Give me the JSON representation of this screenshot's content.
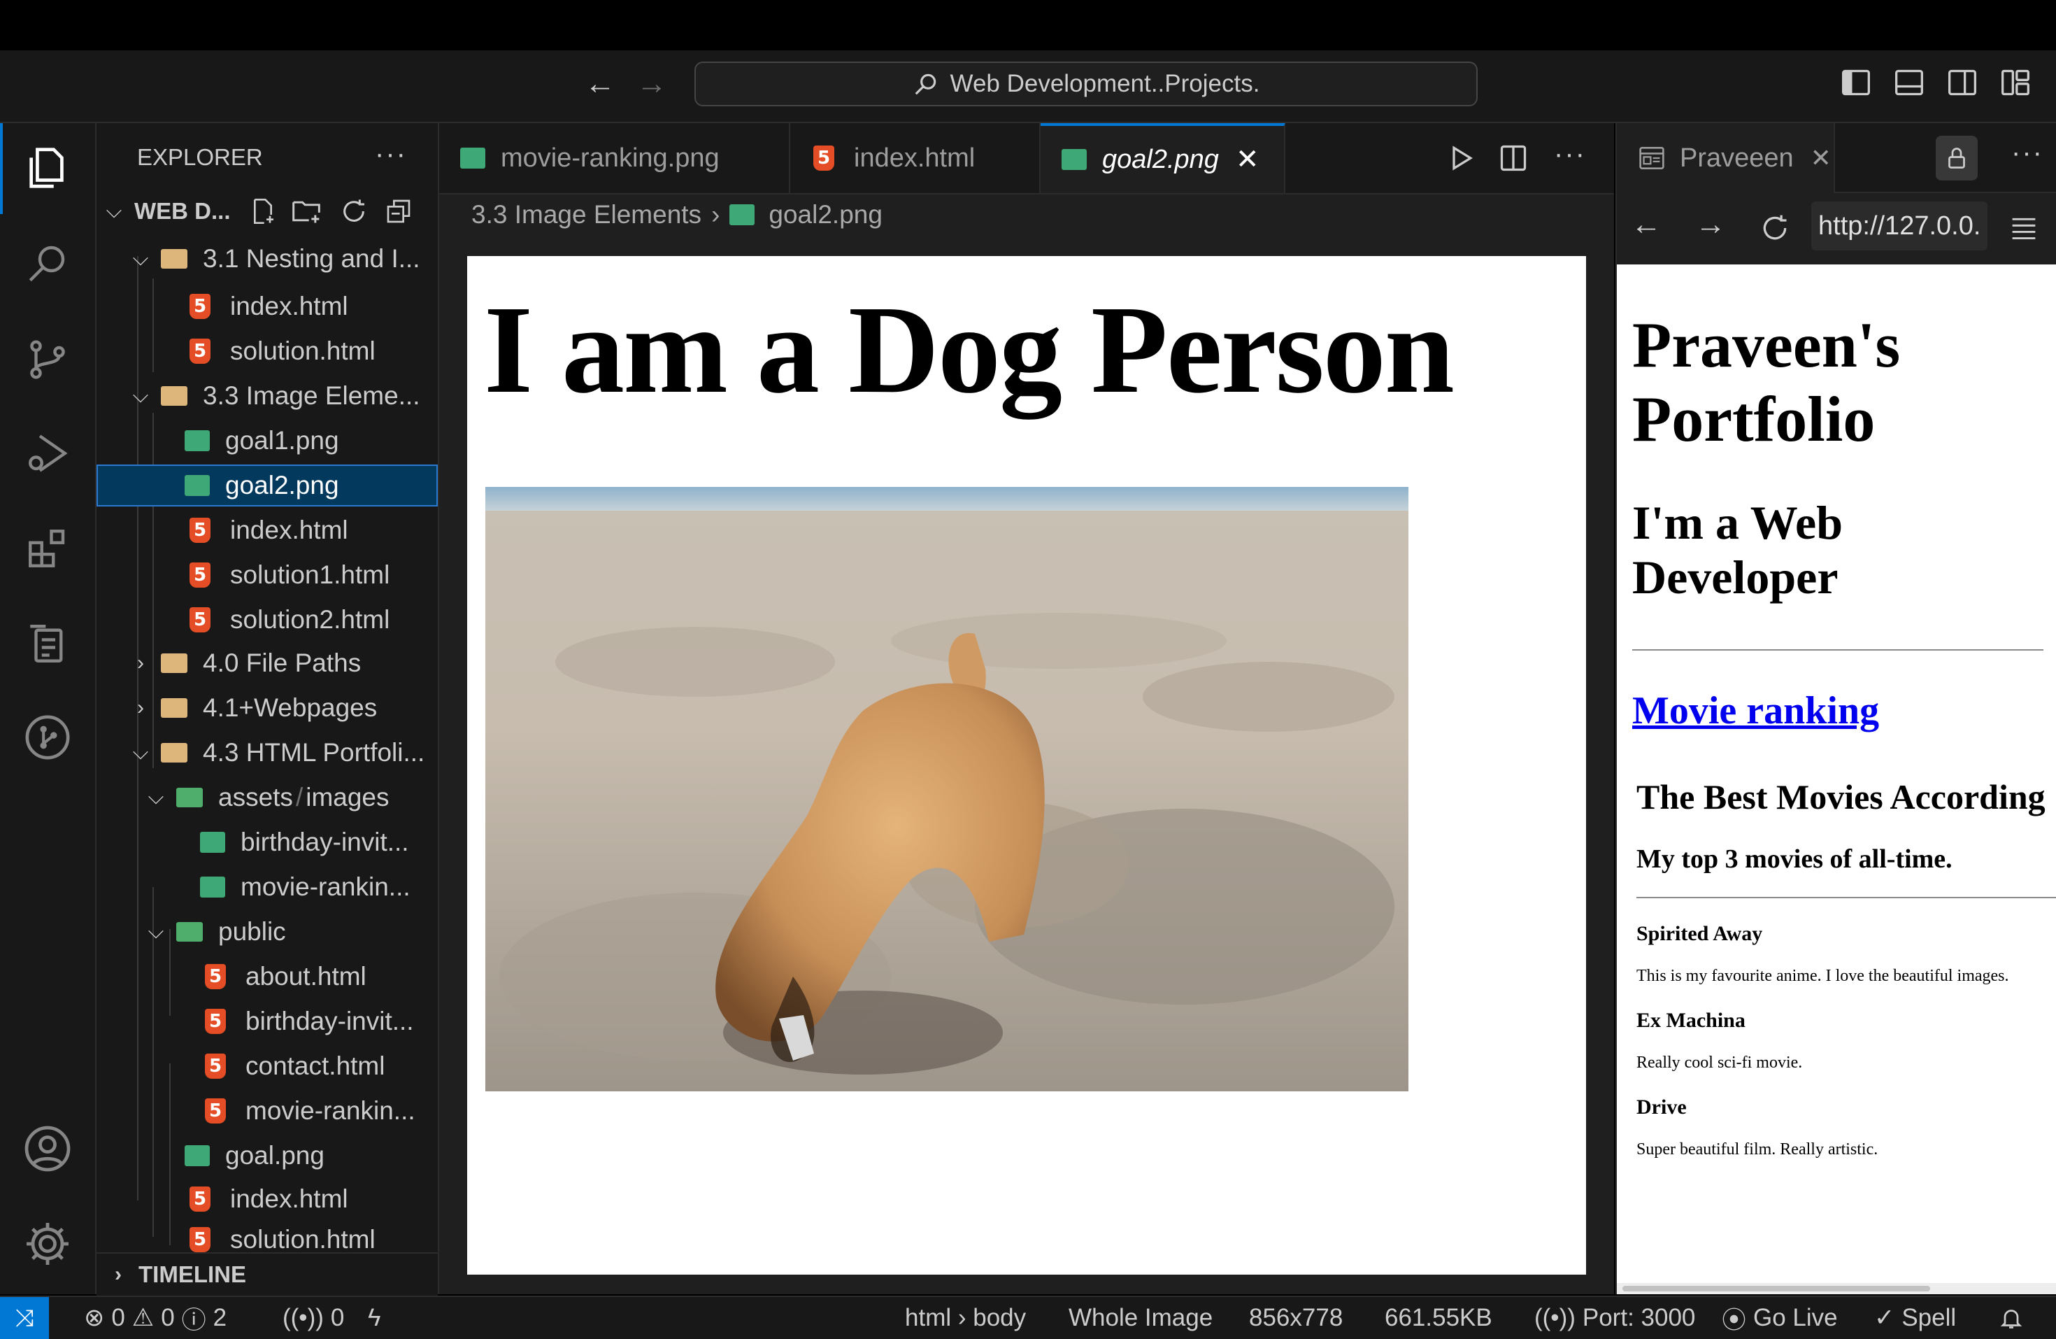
{
  "titlebar": {
    "search_label": "Web Development..Projects."
  },
  "explorer": {
    "title": "EXPLORER",
    "root_label": "WEB D...",
    "rows": [
      {
        "label": "3.1 Nesting and I...",
        "type": "folder-open"
      },
      {
        "label": "index.html",
        "type": "html"
      },
      {
        "label": "solution.html",
        "type": "html"
      },
      {
        "label": "3.3 Image Eleme...",
        "type": "folder-open"
      },
      {
        "label": "goal1.png",
        "type": "image"
      },
      {
        "label": "goal2.png",
        "type": "image",
        "selected": true
      },
      {
        "label": "index.html",
        "type": "html"
      },
      {
        "label": "solution1.html",
        "type": "html"
      },
      {
        "label": "solution2.html",
        "type": "html"
      },
      {
        "label": "4.0 File Paths",
        "type": "folder-closed"
      },
      {
        "label": "4.1+Webpages",
        "type": "folder-closed"
      },
      {
        "label": "4.3 HTML Portfoli...",
        "type": "folder-open"
      },
      {
        "label": "assets",
        "type": "folder-open-green"
      },
      {
        "label": "images",
        "type": "path"
      },
      {
        "label": "birthday-invit...",
        "type": "image"
      },
      {
        "label": "movie-rankin...",
        "type": "image"
      },
      {
        "label": "public",
        "type": "folder-open-green"
      },
      {
        "label": "about.html",
        "type": "html"
      },
      {
        "label": "birthday-invit...",
        "type": "html"
      },
      {
        "label": "contact.html",
        "type": "html"
      },
      {
        "label": "movie-rankin...",
        "type": "html"
      },
      {
        "label": "goal.png",
        "type": "image"
      },
      {
        "label": "index.html",
        "type": "html"
      },
      {
        "label": "solution.html",
        "type": "html"
      }
    ],
    "timeline_label": "TIMELINE"
  },
  "editor": {
    "tabs": [
      {
        "label": "movie-ranking.png",
        "icon": "image-icon"
      },
      {
        "label": "index.html",
        "icon": "html5-icon"
      },
      {
        "label": "goal2.png",
        "icon": "image-icon",
        "active": true
      }
    ],
    "breadcrumb": {
      "folder": "3.3 Image Elements",
      "file": "goal2.png"
    },
    "image_heading": "I am a Dog Person"
  },
  "preview": {
    "tab_label": "Praveeen",
    "url": "http://127.0.0.",
    "page": {
      "title_line1": "Praveen's",
      "title_line2": "Portfolio",
      "subtitle_line1": "I'm a Web",
      "subtitle_line2": "Developer",
      "link": "Movie ranking",
      "movies_heading": "The Best Movies According",
      "movies_sub": "My top 3 movies of all-time.",
      "movies": [
        {
          "title": "Spirited Away",
          "desc": "This is my favourite anime. I love the beautiful images."
        },
        {
          "title": "Ex Machina",
          "desc": "Really cool sci-fi movie."
        },
        {
          "title": "Drive",
          "desc": "Super beautiful film. Really artistic."
        }
      ]
    }
  },
  "statusbar": {
    "errors": "0",
    "warnings": "0",
    "infos": "2",
    "ports": "0",
    "breadcrumb": "html › body",
    "view_mode": "Whole Image",
    "dimensions": "856x778",
    "file_size": "661.55KB",
    "port": "Port: 3000",
    "go_live": "Go Live",
    "spell": "Spell"
  },
  "colors": {
    "accent": "#0078d4",
    "html5": "#e44d26",
    "image_icon": "#3fa877",
    "folder": "#dcb67a",
    "link": "#0000ee"
  }
}
